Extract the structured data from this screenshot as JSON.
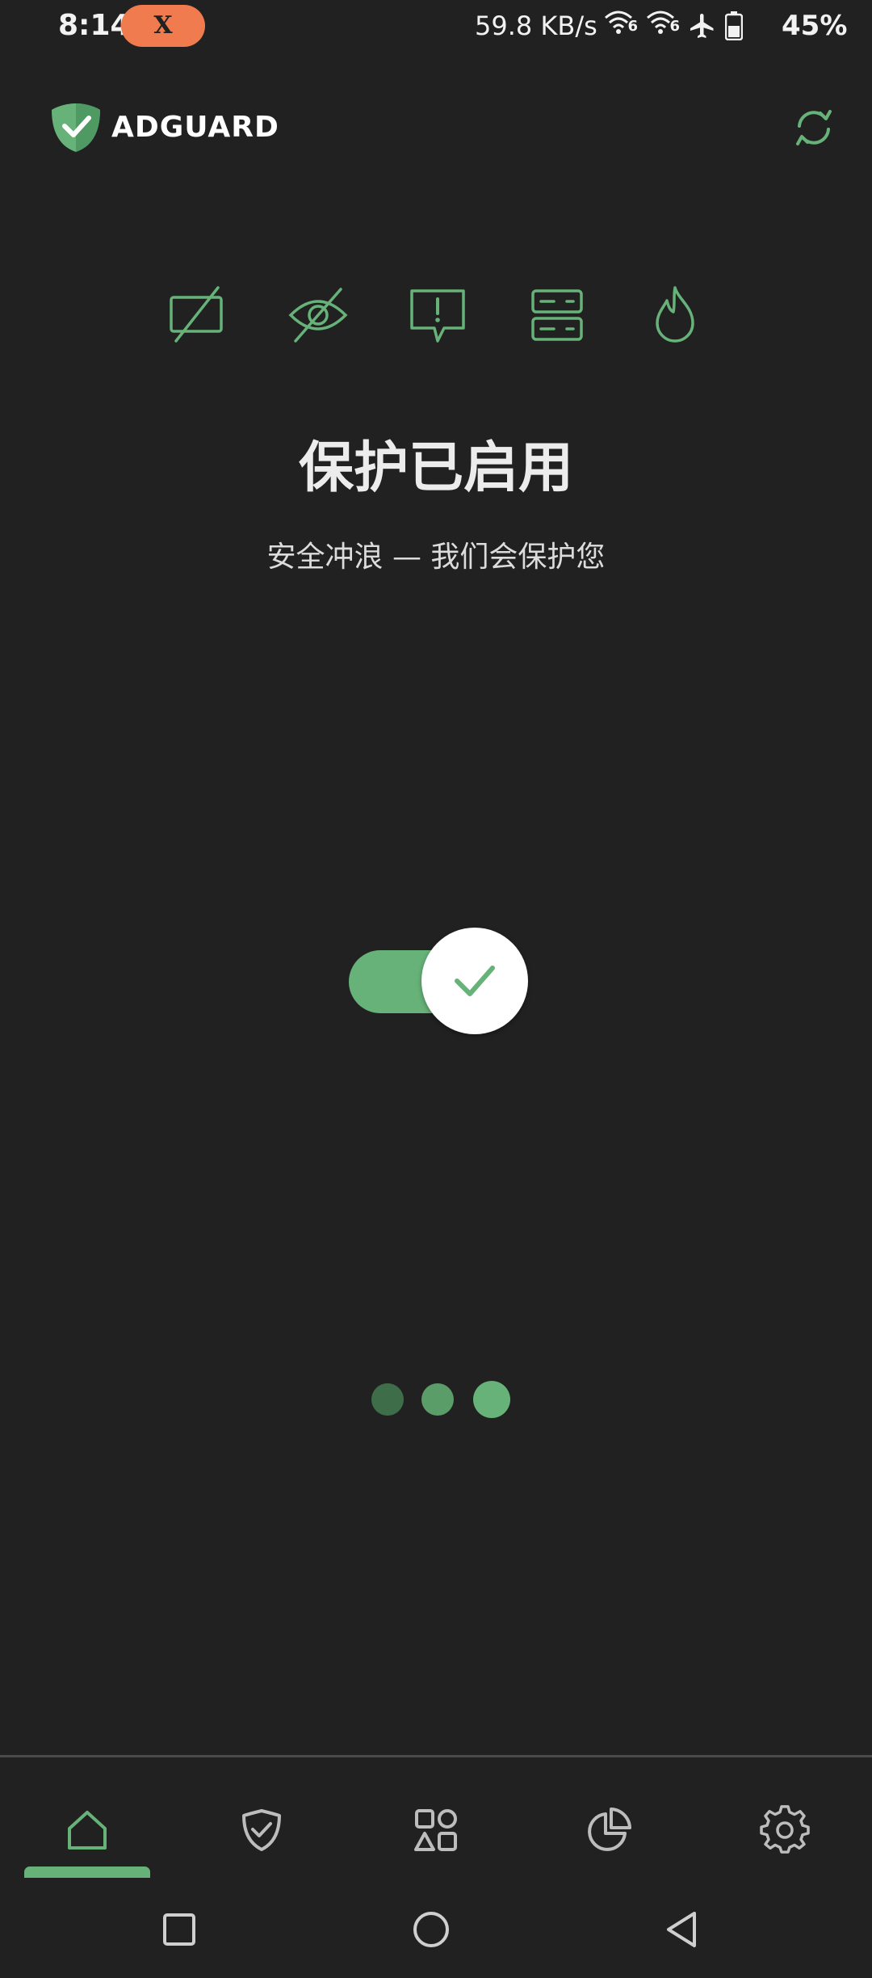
{
  "status_bar": {
    "time": "8:14",
    "pill_label": "X",
    "network_speed": "59.8 KB/s",
    "wifi_badge_1": "6",
    "wifi_badge_2": "6",
    "battery": "45%"
  },
  "header": {
    "brand": "ADGUARD",
    "logo_icon": "shield-check-icon",
    "refresh_icon": "refresh-icon"
  },
  "features": [
    {
      "icon": "ad-block-icon"
    },
    {
      "icon": "tracking-protection-icon"
    },
    {
      "icon": "annoyance-block-icon"
    },
    {
      "icon": "dns-server-icon"
    },
    {
      "icon": "firewall-icon"
    }
  ],
  "protection": {
    "title": "保护已启用",
    "subtitle": "安全冲浪 — 我们会保护您",
    "enabled": true
  },
  "pager": {
    "count": 3,
    "active_index": 2
  },
  "bottom_nav": {
    "items": [
      {
        "name": "home",
        "icon": "home-icon"
      },
      {
        "name": "protection",
        "icon": "shield-check-icon"
      },
      {
        "name": "activity",
        "icon": "apps-shapes-icon"
      },
      {
        "name": "statistics",
        "icon": "pie-chart-icon"
      },
      {
        "name": "settings",
        "icon": "gear-icon"
      }
    ],
    "selected": "home"
  },
  "system_nav": {
    "recents": "square-icon",
    "home": "circle-icon",
    "back": "triangle-back-icon"
  },
  "colors": {
    "background": "#212121",
    "accent": "#67b279",
    "accent_dark": "#3e6e49",
    "accent_mid": "#5a9d69",
    "text": "#ececec",
    "pill": "#f07b4f"
  }
}
